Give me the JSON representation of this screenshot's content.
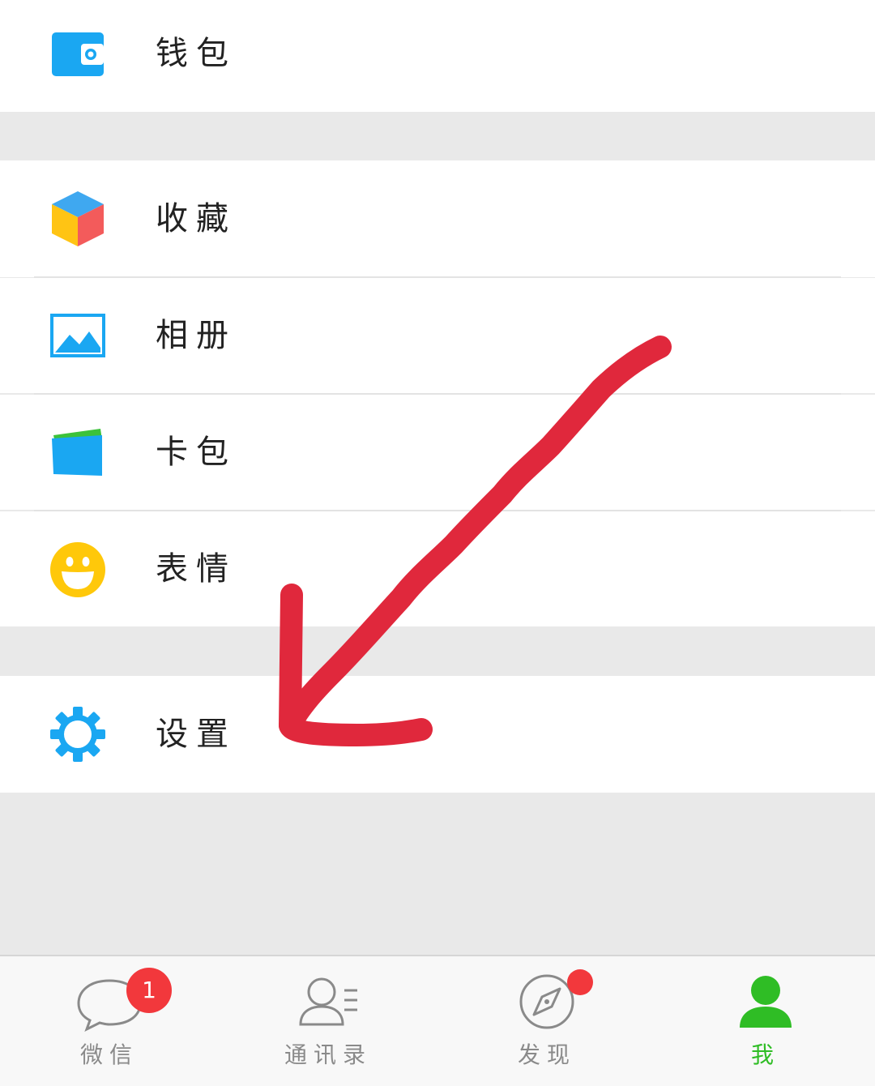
{
  "menu": {
    "wallet": {
      "label": "钱包",
      "icon": "wallet-icon"
    },
    "favorites": {
      "label": "收藏",
      "icon": "cube-icon"
    },
    "album": {
      "label": "相册",
      "icon": "picture-icon"
    },
    "card_wallet": {
      "label": "卡包",
      "icon": "card-icon"
    },
    "stickers": {
      "label": "表情",
      "icon": "smiley-icon"
    },
    "settings": {
      "label": "设置",
      "icon": "gear-icon"
    }
  },
  "tabbar": {
    "tabs": [
      {
        "label": "微信",
        "icon": "chat-bubble-icon",
        "badge": "1",
        "active": false
      },
      {
        "label": "通讯录",
        "icon": "contacts-icon",
        "active": false
      },
      {
        "label": "发现",
        "icon": "compass-icon",
        "dot": true,
        "active": false
      },
      {
        "label": "我",
        "icon": "person-icon",
        "active": true
      }
    ]
  },
  "colors": {
    "accent_blue": "#1aa7f2",
    "active_green": "#2fbd25",
    "badge_red": "#f2383c",
    "annotation_red": "#e0283c",
    "background": "#e9e9e9"
  }
}
